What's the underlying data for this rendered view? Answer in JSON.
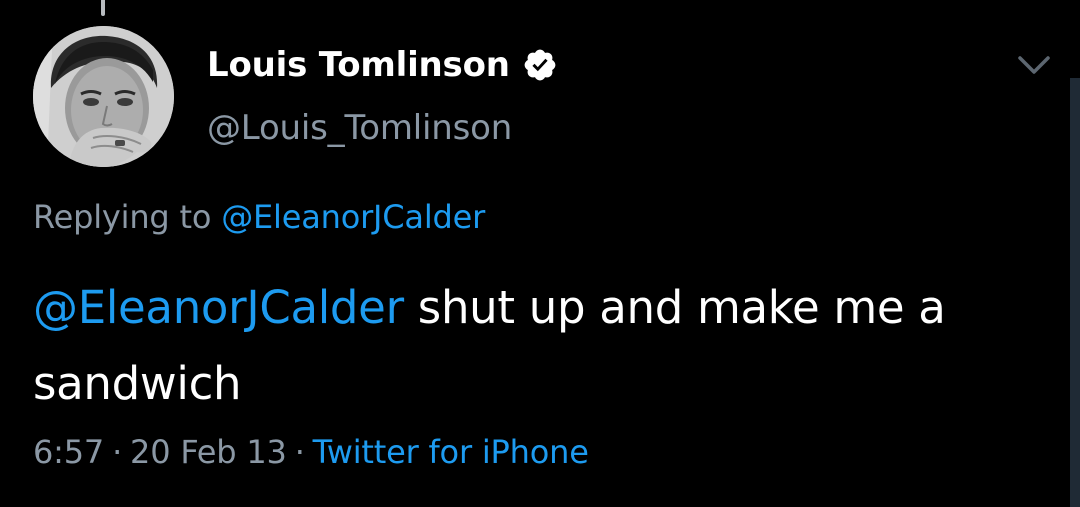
{
  "author": {
    "display_name": "Louis Tomlinson",
    "handle": "@Louis_Tomlinson",
    "verified": true,
    "avatar": "profile-photo"
  },
  "reply": {
    "prefix": "Replying to",
    "to": "@EleanorJCalder"
  },
  "tweet": {
    "mention": "@EleanorJCalder",
    "body": "shut up and make me a sandwich"
  },
  "meta": {
    "time": "6:57",
    "separator": "·",
    "date": "20 Feb 13",
    "source": "Twitter for iPhone"
  },
  "icons": {
    "verified": "verified-badge-icon",
    "menu": "chevron-down-icon"
  },
  "colors": {
    "background": "#000000",
    "primary_text": "#ffffff",
    "secondary_text": "#8b98a5",
    "link": "#1d9bf0"
  }
}
